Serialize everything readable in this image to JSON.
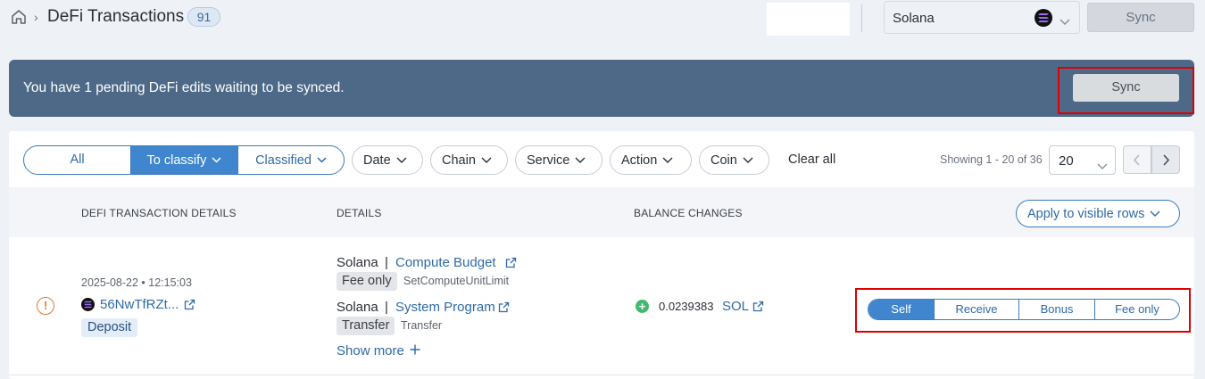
{
  "header": {
    "title": "DeFi Transactions",
    "count": "91",
    "chain_select": {
      "value": "Solana"
    },
    "sync_label": "Sync"
  },
  "banner": {
    "message": "You have 1 pending DeFi edits waiting to be synced.",
    "sync_label": "Sync"
  },
  "filters": {
    "tabs": [
      "All",
      "To classify",
      "Classified"
    ],
    "active_tab": "To classify",
    "dropdowns": [
      "Date",
      "Chain",
      "Service",
      "Action",
      "Coin"
    ],
    "clear_all": "Clear all",
    "showing": "Showing 1 - 20 of 36",
    "per_page": "20"
  },
  "table": {
    "columns": [
      "DEFI TRANSACTION DETAILS",
      "DETAILS",
      "BALANCE CHANGES"
    ],
    "apply_button": "Apply to visible rows",
    "rows": [
      {
        "timestamp": "2025-08-22 • 12:15:03",
        "hash": "56NwTfRZt...",
        "type": "Deposit",
        "details": [
          {
            "chain": "Solana",
            "separator": "|",
            "service": "Compute Budget",
            "tag": "Fee only",
            "instruction": "SetComputeUnitLimit"
          },
          {
            "chain": "Solana",
            "separator": "|",
            "service": "System Program",
            "tag": "Transfer",
            "instruction": "Transfer"
          }
        ],
        "show_more": "Show more",
        "balance": {
          "sign": "+",
          "amount": "0.0239383",
          "coin": "SOL"
        },
        "classifications": [
          "Self",
          "Receive",
          "Bonus",
          "Fee only"
        ],
        "selected_classification": "Self"
      }
    ]
  },
  "colors": {
    "banner_bg": "#4d6987",
    "accent": "#3f86cf",
    "highlight": "#e00000",
    "warning": "#e07b39",
    "positive": "#42b96e"
  }
}
